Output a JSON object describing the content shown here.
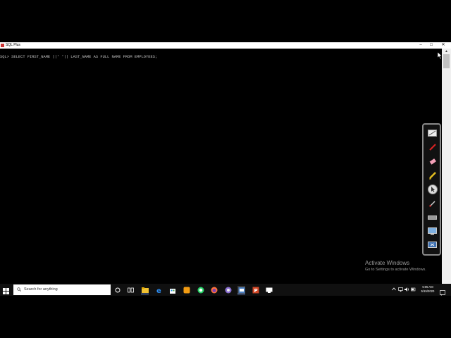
{
  "window": {
    "title": "SQL Plus",
    "controls": {
      "minimize": "–",
      "maximize": "□",
      "close": "✕"
    }
  },
  "console": {
    "line": "SQL> SELECT FIRST_NAME ||' '|| LAST_NAME AS FULL NAME FROM EMPLOYEES;"
  },
  "pen_toolbar": {
    "tools": [
      "whiteboard-icon",
      "red-pen-icon",
      "eraser-icon",
      "highlighter-icon",
      "pointer-icon",
      "laser-pen-icon",
      "clear-icon",
      "screen-capture-icon",
      "exit-icon"
    ]
  },
  "watermark": {
    "title": "Activate Windows",
    "subtitle": "Go to Settings to activate Windows."
  },
  "taskbar": {
    "search_placeholder": "Search for anything",
    "apps": [
      "cortana-icon",
      "task-view-icon",
      "file-explorer-icon",
      "edge-icon",
      "store-icon",
      "folder-icon",
      "whatsapp-icon",
      "firefox-icon",
      "browser-icon",
      "sqlplus-icon",
      "powerpoint-icon",
      "app-icon"
    ],
    "time": "5:05 AM",
    "date": "5/15/2020"
  }
}
